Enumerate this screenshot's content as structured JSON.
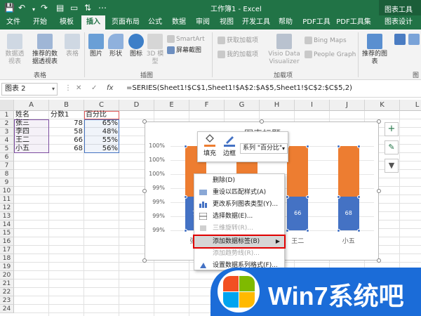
{
  "titlebar": {
    "title": "工作簿1 - Excel",
    "context_tab_group": "图表工具"
  },
  "tabs": [
    "文件",
    "开始",
    "模板",
    "插入",
    "页面布局",
    "公式",
    "数据",
    "审阅",
    "视图",
    "开发工具",
    "帮助",
    "PDF工具",
    "PDF工具集",
    "图表设计"
  ],
  "active_tab": "插入",
  "ribbon": {
    "tables_group": {
      "label": "表格",
      "pivot": "数据透视表",
      "recommended_pivot": "推荐的数据透视表",
      "table": "表格"
    },
    "illustrations_group": {
      "label": "插图",
      "pictures": "图片",
      "shapes": "形状",
      "icons": "图标",
      "models3d": "3D 模型",
      "smartart": "SmartArt",
      "screenshot": "屏幕截图"
    },
    "addins_group": {
      "label": "加载项",
      "get_addins": "获取加载项",
      "my_addins": "我的加载项",
      "visio": "Visio Data Visualizer",
      "bing_maps": "Bing Maps",
      "people_graph": "People Graph"
    },
    "charts": {
      "recommended": "推荐的图表"
    },
    "extra_label": "图"
  },
  "formula_bar": {
    "name_box": "图表 2",
    "cancel": "✕",
    "enter": "✓",
    "fx": "fx",
    "formula": "=SERIES(Sheet1!$C$1,Sheet1!$A$2:$A$5,Sheet1!$C$2:$C$5,2)"
  },
  "columns": [
    "A",
    "B",
    "C",
    "D",
    "E",
    "F",
    "G",
    "H",
    "I",
    "J",
    "K",
    "L"
  ],
  "rows": [
    "1",
    "2",
    "3",
    "4",
    "5",
    "6",
    "7",
    "8",
    "9",
    "10",
    "11",
    "12",
    "13",
    "14",
    "15",
    "16",
    "17",
    "18",
    "19",
    "20",
    "21",
    "22",
    "23",
    "24"
  ],
  "sheet": {
    "header": [
      "姓名",
      "分数1",
      "百分比"
    ],
    "data": [
      [
        "张三",
        "78",
        "65%"
      ],
      [
        "李四",
        "58",
        "48%"
      ],
      [
        "王二",
        "66",
        "55%"
      ],
      [
        "小五",
        "68",
        "56%"
      ]
    ]
  },
  "chart_data": {
    "type": "bar",
    "title": "图表标题",
    "categories": [
      "张三",
      "李四",
      "王二",
      "小五"
    ],
    "series": [
      {
        "name": "分数1",
        "values": [
          78,
          58,
          66,
          68
        ],
        "color": "#4472c4"
      },
      {
        "name": "百分比",
        "values": [
          0.65,
          0.48,
          0.55,
          0.56
        ],
        "color": "#ed7d31"
      }
    ],
    "yticks": [
      "100%",
      "100%",
      "100%",
      "99%",
      "99%",
      "99%",
      "99%"
    ],
    "stacked_percent": true
  },
  "mini_toolbar": {
    "fill": "填充",
    "outline": "边框",
    "series_select": "系列 \"百分比\""
  },
  "context_menu": [
    {
      "label": "删除(D)",
      "enabled": true
    },
    {
      "label": "重设以匹配样式(A)",
      "enabled": true
    },
    {
      "label": "更改系列图表类型(Y)...",
      "enabled": true
    },
    {
      "label": "选择数据(E)...",
      "enabled": true
    },
    {
      "label": "三维旋转(R)...",
      "enabled": false
    },
    {
      "label": "添加数据标签(B)",
      "enabled": true,
      "submenu": true,
      "highlighted": true
    },
    {
      "label": "添加趋势线(R)...",
      "enabled": false
    },
    {
      "label": "设置数据系列格式(F)...",
      "enabled": true
    }
  ],
  "watermark": {
    "text": "Win7系统吧"
  },
  "colors": {
    "excel_green": "#217346",
    "series_blue": "#4472c4",
    "series_orange": "#ed7d31",
    "watermark_blue": "#1b6cd8"
  }
}
